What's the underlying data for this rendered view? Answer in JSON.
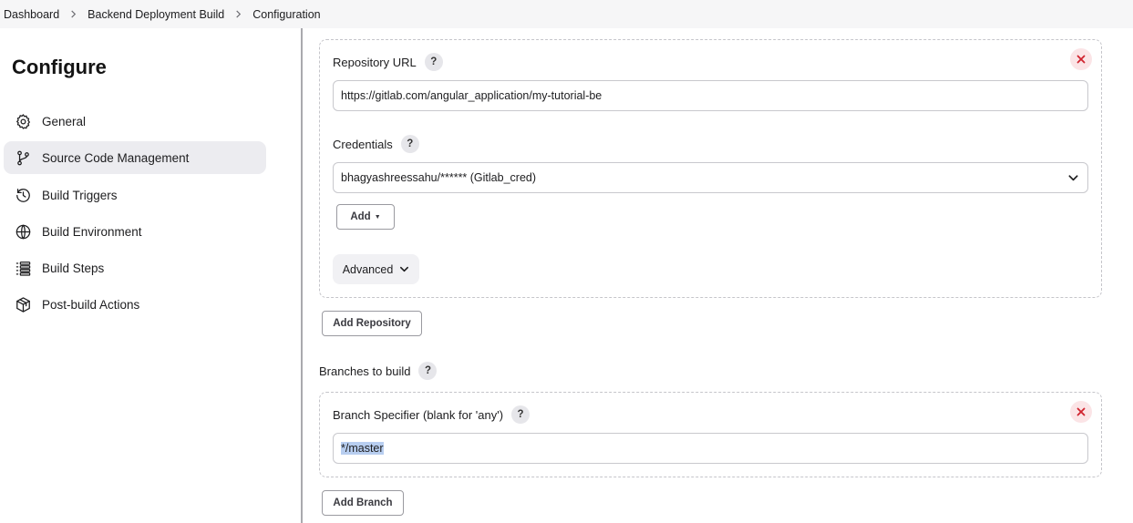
{
  "breadcrumb": {
    "items": [
      "Dashboard",
      "Backend Deployment Build",
      "Configuration"
    ]
  },
  "sidebar": {
    "title": "Configure",
    "items": [
      {
        "label": "General",
        "icon": "gear-icon"
      },
      {
        "label": "Source Code Management",
        "icon": "git-branch-icon",
        "active": true
      },
      {
        "label": "Build Triggers",
        "icon": "clock-icon"
      },
      {
        "label": "Build Environment",
        "icon": "globe-icon"
      },
      {
        "label": "Build Steps",
        "icon": "list-icon"
      },
      {
        "label": "Post-build Actions",
        "icon": "package-icon"
      }
    ]
  },
  "repository": {
    "url_label": "Repository URL",
    "url_value": "https://gitlab.com/angular_application/my-tutorial-be",
    "credentials_label": "Credentials",
    "credentials_value": "bhagyashreessahu/****** (Gitlab_cred)",
    "add_label": "Add",
    "advanced_label": "Advanced",
    "help_glyph": "?"
  },
  "add_repository_label": "Add Repository",
  "branches": {
    "section_label": "Branches to build",
    "specifier_label": "Branch Specifier (blank for 'any')",
    "specifier_value": "*/master",
    "add_branch_label": "Add Branch"
  },
  "colors": {
    "accent_selection": "#b8cef0",
    "close_red": "#d0242f",
    "active_nav_bg": "#ececf0"
  }
}
